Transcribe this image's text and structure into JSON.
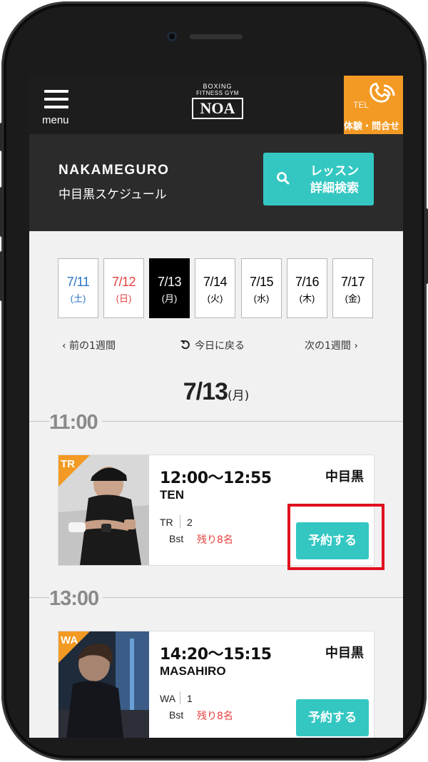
{
  "header": {
    "menu_label": "menu",
    "logo_line1": "BOXING",
    "logo_line2": "FITNESS GYM",
    "logo_line3": "NOA",
    "tel_icon_text": "TEL",
    "tel_label": "体験・問合せ"
  },
  "location": {
    "name_en": "NAKAMEGURO",
    "name_jp": "中目黒スケジュール",
    "search_line1": "レッスン",
    "search_line2": "詳細検索"
  },
  "dates": [
    {
      "date": "7/11",
      "weekday": "(土)",
      "kind": "sat"
    },
    {
      "date": "7/12",
      "weekday": "(日)",
      "kind": "sun"
    },
    {
      "date": "7/13",
      "weekday": "(月)",
      "kind": "active"
    },
    {
      "date": "7/14",
      "weekday": "(火)",
      "kind": "normal"
    },
    {
      "date": "7/15",
      "weekday": "(水)",
      "kind": "normal"
    },
    {
      "date": "7/16",
      "weekday": "(木)",
      "kind": "normal"
    },
    {
      "date": "7/17",
      "weekday": "(金)",
      "kind": "normal"
    }
  ],
  "nav": {
    "prev": "‹  前の1週間",
    "today": "今日に戻る",
    "next": "次の1週間  ›"
  },
  "day": {
    "date": "7/13",
    "weekday": "(月)"
  },
  "hours": [
    "11:00",
    "13:00"
  ],
  "classes": [
    {
      "badge": "TR",
      "time": "12:00〜12:55",
      "instructor": "TEN",
      "location": "中目黒",
      "code": "TR",
      "number": "2",
      "level": "Bst",
      "remaining": "残り8名",
      "reserve_label": "予約する"
    },
    {
      "badge": "WA",
      "time": "14:20〜15:15",
      "instructor": "MASAHIRO",
      "location": "中目黒",
      "code": "WA",
      "number": "1",
      "level": "Bst",
      "remaining": "残り8名",
      "reserve_label": "予約する"
    }
  ],
  "colors": {
    "accent_teal": "#34c7c2",
    "accent_orange": "#f39a24",
    "highlight_red": "#e0101e"
  }
}
